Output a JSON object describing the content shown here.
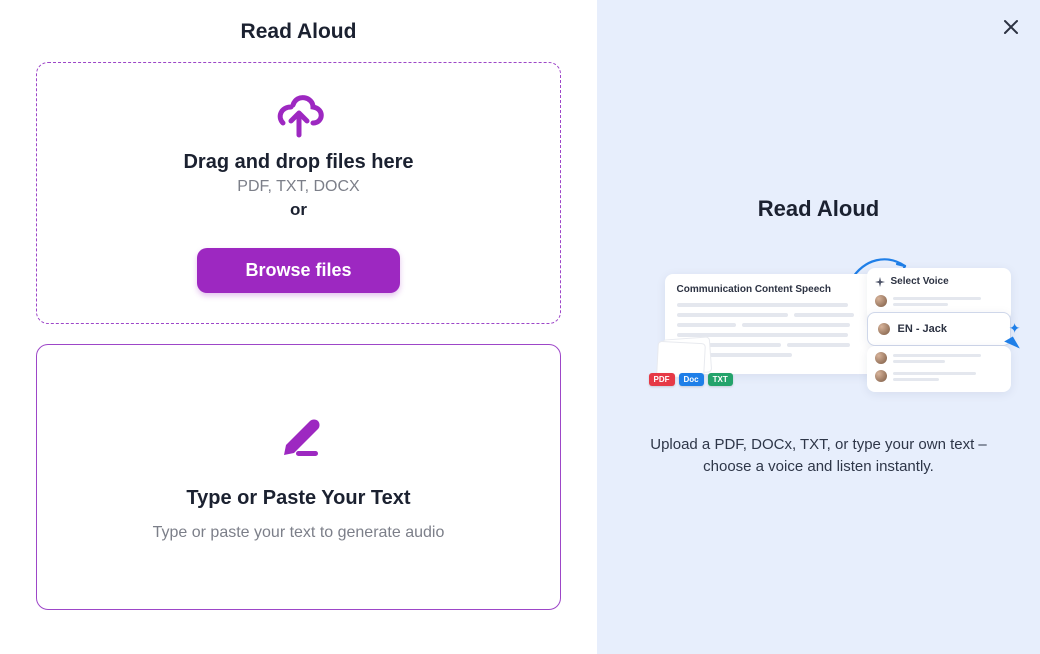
{
  "left": {
    "title": "Read Aloud",
    "dropzone": {
      "heading": "Drag and drop files here",
      "formats": "PDF, TXT, DOCX",
      "or": "or",
      "browse_label": "Browse files"
    },
    "typebox": {
      "heading": "Type or Paste Your Text",
      "placeholder": "Type or paste your text to generate audio"
    }
  },
  "right": {
    "title": "Read Aloud",
    "illustration": {
      "content_card_title": "Communication Content Speech",
      "select_voice_label": "Select Voice",
      "selected_voice": "EN - Jack",
      "file_badges": {
        "pdf": "PDF",
        "doc": "Doc",
        "txt": "TXT"
      }
    },
    "description": "Upload a PDF, DOCx, TXT, or type your own text – choose a voice and listen instantly."
  },
  "colors": {
    "accent": "#9d28c1",
    "panel_bg": "#e7eefc"
  }
}
